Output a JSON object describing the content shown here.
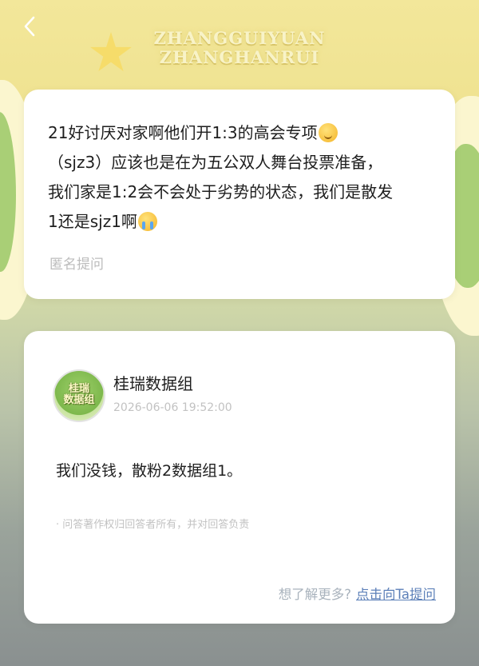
{
  "header": {
    "back_icon": "chevron-left-icon",
    "banner_line1": "ZHANGGUIYUAN",
    "banner_line2": "ZHANGHANRUI"
  },
  "question": {
    "text_1": "21好讨厌对家啊他们开1:3的高会专项",
    "text_2": "（sjz3）应该也是在为五公双人舞台投票准备，\n我们家是1:2会不会处于劣势的状态，我们是散发\n1还是sjz1啊",
    "emoji_1": "slight-smile-emoji",
    "emoji_2": "crying-emoji",
    "anon_label": "匿名提问"
  },
  "answer": {
    "avatar_text": "桂瑞\n数据组",
    "author": "桂瑞数据组",
    "timestamp": "2026-06-06 19:52:00",
    "body": "我们没钱，散粉2数据组1。",
    "copyright": "· 问答著作权归回答者所有，并对回答负责",
    "more_prompt": "想了解更多?",
    "ask_link": "点击向Ta提问"
  },
  "colors": {
    "background_top": "#f3e79a",
    "background_bottom": "#8a9090",
    "card": "#ffffff",
    "link": "#5b7fb8",
    "muted": "#c2c2c2"
  }
}
